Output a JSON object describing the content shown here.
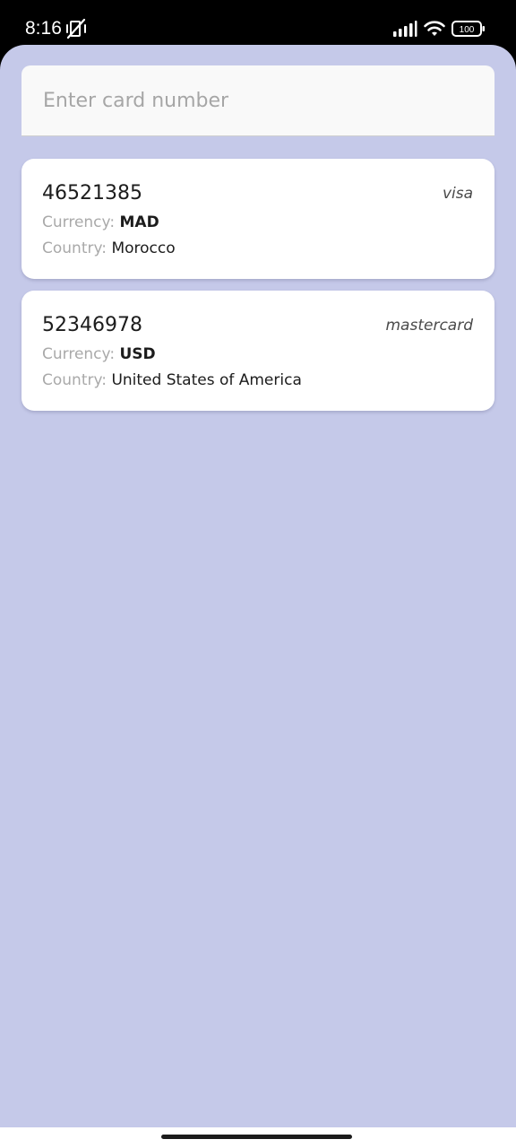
{
  "status_bar": {
    "time": "8:16",
    "icons": [
      "mute-vibrate-icon",
      "signal-icon",
      "wifi-icon",
      "battery-icon"
    ],
    "battery_level": "100"
  },
  "search": {
    "placeholder": "Enter card number",
    "value": ""
  },
  "labels": {
    "currency": "Currency:",
    "country": "Country:"
  },
  "cards": [
    {
      "number": "46521385",
      "brand": "visa",
      "currency": "MAD",
      "country": "Morocco"
    },
    {
      "number": "52346978",
      "brand": "mastercard",
      "currency": "USD",
      "country": "United States of America"
    }
  ],
  "colors": {
    "background": "#c5c9e9",
    "card": "#ffffff",
    "search_field": "#f9f9f9",
    "label_gray": "#a9a9a9",
    "text_dark": "#1c1c1c"
  }
}
